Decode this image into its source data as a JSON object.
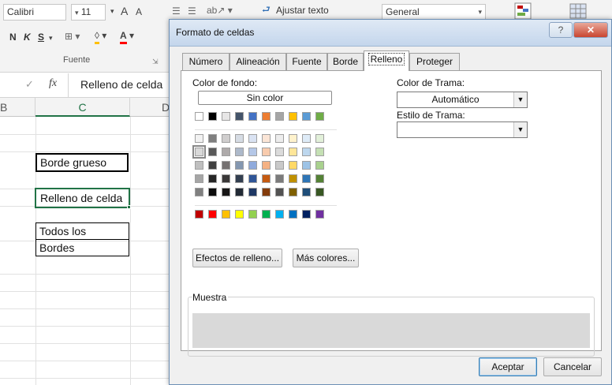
{
  "ribbon": {
    "font_name": "Calibri",
    "font_size": "11",
    "grow_font": "A",
    "shrink_font": "A",
    "bold": "N",
    "italic": "K",
    "underline": "S",
    "wrap_text": "Ajustar texto",
    "number_format": "General",
    "group_font_label": "Fuente"
  },
  "formula_bar": {
    "fx": "fx",
    "content": "Relleno de celda"
  },
  "sheet": {
    "columns": [
      "B",
      "C",
      "D"
    ],
    "cells": [
      "Borde grueso",
      "Relleno de celda",
      "Todos los",
      "Bordes"
    ]
  },
  "dialog": {
    "title": "Formato de celdas",
    "help": "?",
    "close": "✕",
    "tabs": [
      "Número",
      "Alineación",
      "Fuente",
      "Borde",
      "Relleno",
      "Proteger"
    ],
    "active_tab": "Relleno",
    "background_color_label": "Color de fondo:",
    "no_color": "Sin color",
    "pattern_color_label": "Color de Trama:",
    "pattern_color_value": "Automático",
    "pattern_style_label": "Estilo de Trama:",
    "pattern_style_value": "",
    "fill_effects_button": "Efectos de relleno...",
    "more_colors_button": "Más colores...",
    "sample_label": "Muestra",
    "ok_button": "Aceptar",
    "cancel_button": "Cancelar"
  },
  "palette": {
    "row0": [
      "#ffffff",
      "#000000",
      "#e7e6e6",
      "#44546a",
      "#4472c4",
      "#ed7d31",
      "#a5a5a5",
      "#ffc000",
      "#5b9bd5",
      "#70ad47"
    ],
    "theme_rows": [
      [
        "#f2f2f2",
        "#7f7f7f",
        "#d0cece",
        "#d6dce4",
        "#dae3f3",
        "#fbe5d6",
        "#ededed",
        "#fff2cc",
        "#deebf7",
        "#e2f0d9"
      ],
      [
        "#d9d9d9",
        "#595959",
        "#aeaaaa",
        "#adb9ca",
        "#b4c7e7",
        "#f8cbad",
        "#dbdbdb",
        "#ffe699",
        "#bdd7ee",
        "#c5e0b4"
      ],
      [
        "#bfbfbf",
        "#404040",
        "#757171",
        "#8497b0",
        "#8faadc",
        "#f4b183",
        "#c9c9c9",
        "#ffd966",
        "#9dc3e6",
        "#a9d18e"
      ],
      [
        "#a6a6a6",
        "#262626",
        "#3a3838",
        "#333f50",
        "#2f5597",
        "#c55a11",
        "#7b7b7b",
        "#bf9000",
        "#2e75b6",
        "#548235"
      ],
      [
        "#808080",
        "#0d0d0d",
        "#171616",
        "#222a35",
        "#1f3864",
        "#843c0c",
        "#525252",
        "#7f6000",
        "#1f4e79",
        "#385723"
      ]
    ],
    "standard": [
      "#c00000",
      "#ff0000",
      "#ffc000",
      "#ffff00",
      "#92d050",
      "#00b050",
      "#00b0f0",
      "#0070c0",
      "#002060",
      "#7030a0"
    ],
    "sample_color": "#d9d9d9"
  }
}
